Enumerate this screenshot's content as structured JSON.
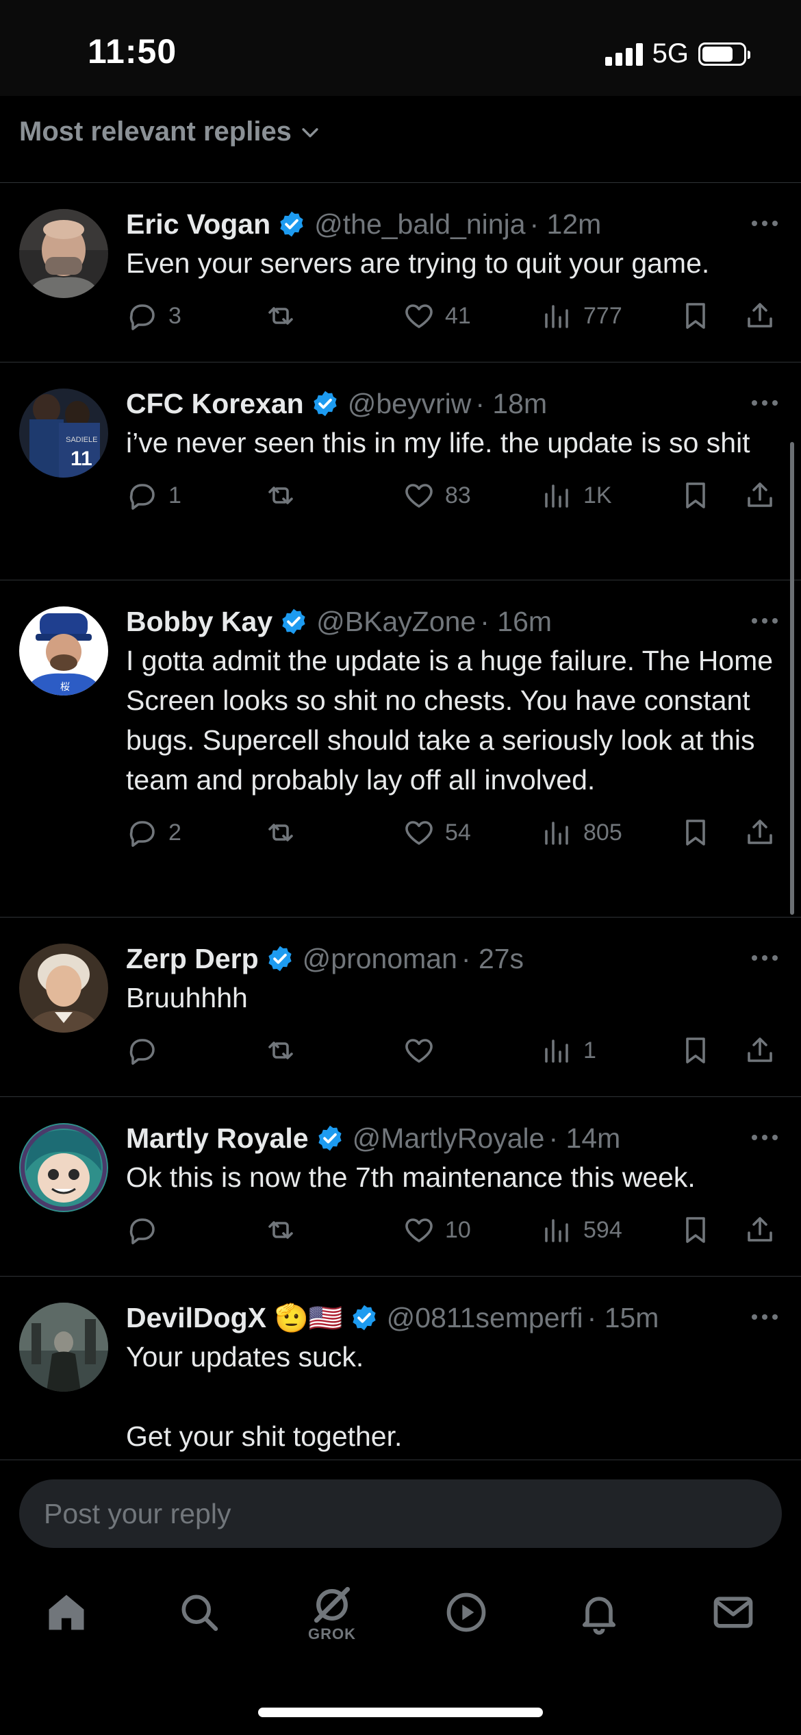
{
  "status_bar": {
    "time": "11:50",
    "network": "5G",
    "battery_level": 0.75
  },
  "sort": {
    "label": "Most relevant replies"
  },
  "colors": {
    "background": "#000000",
    "verified_badge": "#1d9bf0",
    "secondary_text": "#71767b",
    "divider": "#2f3336"
  },
  "replies": [
    {
      "display_name": "Eric Vogan",
      "handle": "@the_bald_ninja",
      "time": "· 12m",
      "text": "Even your servers are trying to quit your game.",
      "replies_count": "3",
      "reposts_count": "",
      "likes_count": "41",
      "views_count": "777"
    },
    {
      "display_name": "CFC Korexan",
      "handle": "@beyvriw",
      "time": "· 18m",
      "text": "i’ve never seen this in my life. the update is so shit",
      "replies_count": "1",
      "reposts_count": "",
      "likes_count": "83",
      "views_count": "1K"
    },
    {
      "display_name": "Bobby Kay",
      "handle": "@BKayZone",
      "time": "· 16m",
      "text": "I gotta admit the update is a huge failure. The Home Screen looks so shit no chests. You have constant bugs. Supercell should take a seriously look at this team and probably lay off all involved.",
      "replies_count": "2",
      "reposts_count": "",
      "likes_count": "54",
      "views_count": "805"
    },
    {
      "display_name": "Zerp Derp",
      "handle": "@pronoman",
      "time": "· 27s",
      "text": "Bruuhhhh",
      "replies_count": "",
      "reposts_count": "",
      "likes_count": "",
      "views_count": "1"
    },
    {
      "display_name": "Martly Royale",
      "handle": "@MartlyRoyale",
      "time": "· 14m",
      "text": "Ok this is now the 7th maintenance this week.",
      "replies_count": "",
      "reposts_count": "",
      "likes_count": "10",
      "views_count": "594"
    },
    {
      "display_name": "DevilDogX",
      "emoji": "🫡🇺🇸",
      "handle": "@0811semperfi",
      "time": "· 15m",
      "text": "Your updates suck.\n\nGet your shit together."
    }
  ],
  "composer": {
    "placeholder": "Post your reply"
  },
  "tab_bar": {
    "grok_label": "GROK",
    "icons": [
      "home-icon",
      "search-icon",
      "grok-icon",
      "video-icon",
      "notifications-icon",
      "messages-icon"
    ]
  }
}
